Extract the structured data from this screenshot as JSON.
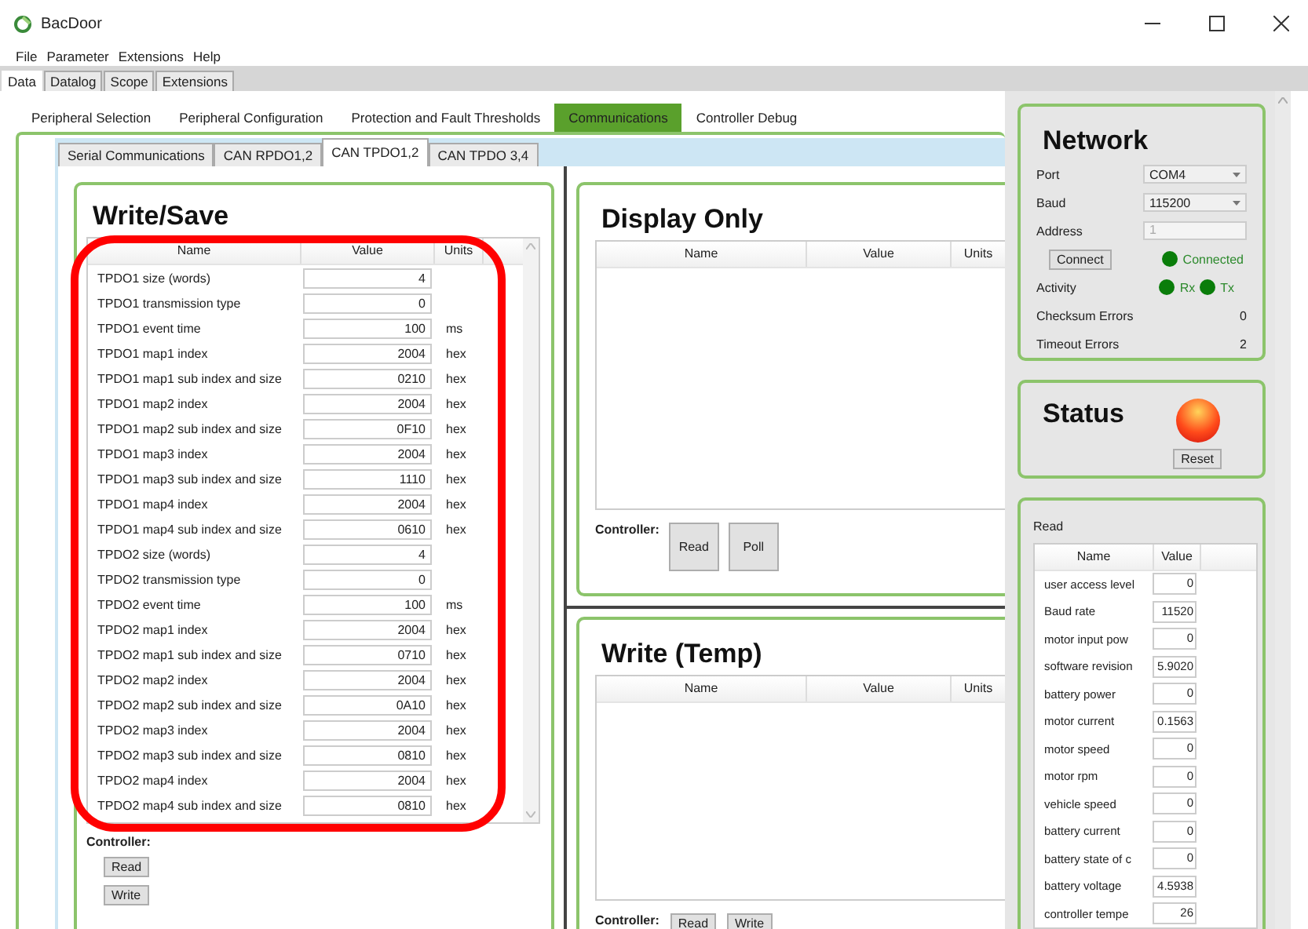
{
  "window": {
    "title": "BacDoor"
  },
  "menu": [
    "File",
    "Parameter",
    "Extensions",
    "Help"
  ],
  "main_tabs": [
    {
      "label": "Data",
      "selected": true
    },
    {
      "label": "Datalog",
      "selected": false
    },
    {
      "label": "Scope",
      "selected": false
    },
    {
      "label": "Extensions",
      "selected": false
    }
  ],
  "section_tabs": [
    {
      "label": "Peripheral Selection",
      "selected": false
    },
    {
      "label": "Peripheral Configuration",
      "selected": false
    },
    {
      "label": "Protection and Fault Thresholds",
      "selected": false
    },
    {
      "label": "Communications",
      "selected": true
    },
    {
      "label": "Controller Debug",
      "selected": false
    }
  ],
  "comm_tabs": [
    {
      "label": "Serial Communications",
      "selected": false
    },
    {
      "label": "CAN RPDO1,2",
      "selected": false
    },
    {
      "label": "CAN TPDO1,2",
      "selected": true
    },
    {
      "label": "CAN TPDO 3,4",
      "selected": false
    }
  ],
  "write_save": {
    "title": "Write/Save",
    "columns": [
      "Name",
      "Value",
      "Units"
    ],
    "rows": [
      {
        "name": "TPDO1 size (words)",
        "value": "4"
      },
      {
        "name": "TPDO1 transmission type",
        "value": "0"
      },
      {
        "name": "TPDO1 event time",
        "value": "100",
        "unit": "ms"
      },
      {
        "name": "TPDO1 map1 index",
        "value": "2004",
        "unit": "hex"
      },
      {
        "name": "TPDO1 map1 sub index and size",
        "value": "0210",
        "unit": "hex"
      },
      {
        "name": "TPDO1 map2 index",
        "value": "2004",
        "unit": "hex"
      },
      {
        "name": "TPDO1 map2 sub index and size",
        "value": "0F10",
        "unit": "hex"
      },
      {
        "name": "TPDO1 map3 index",
        "value": "2004",
        "unit": "hex"
      },
      {
        "name": "TPDO1 map3 sub index and size",
        "value": "1110",
        "unit": "hex"
      },
      {
        "name": "TPDO1 map4 index",
        "value": "2004",
        "unit": "hex"
      },
      {
        "name": "TPDO1 map4 sub index and size",
        "value": "0610",
        "unit": "hex"
      },
      {
        "name": "TPDO2 size (words)",
        "value": "4"
      },
      {
        "name": "TPDO2 transmission type",
        "value": "0"
      },
      {
        "name": "TPDO2 event time",
        "value": "100",
        "unit": "ms"
      },
      {
        "name": "TPDO2 map1 index",
        "value": "2004",
        "unit": "hex"
      },
      {
        "name": "TPDO2 map1 sub index and size",
        "value": "0710",
        "unit": "hex"
      },
      {
        "name": "TPDO2 map2 index",
        "value": "2004",
        "unit": "hex"
      },
      {
        "name": "TPDO2 map2 sub index and size",
        "value": "0A10",
        "unit": "hex"
      },
      {
        "name": "TPDO2 map3 index",
        "value": "2004",
        "unit": "hex"
      },
      {
        "name": "TPDO2 map3 sub index and size",
        "value": "0810",
        "unit": "hex"
      },
      {
        "name": "TPDO2 map4 index",
        "value": "2004",
        "unit": "hex"
      },
      {
        "name": "TPDO2 map4 sub index and size",
        "value": "0810",
        "unit": "hex"
      }
    ],
    "controller_label": "Controller:",
    "buttons": [
      "Read",
      "Write"
    ]
  },
  "display_only": {
    "title": "Display Only",
    "columns": [
      "Name",
      "Value",
      "Units"
    ],
    "controller_label": "Controller:",
    "buttons": [
      "Read",
      "Poll"
    ]
  },
  "write_temp": {
    "title": "Write (Temp)",
    "columns": [
      "Name",
      "Value",
      "Units"
    ],
    "controller_label": "Controller:",
    "buttons": [
      "Read",
      "Write"
    ]
  },
  "network": {
    "title": "Network",
    "port": {
      "label": "Port",
      "value": "COM4"
    },
    "baud": {
      "label": "Baud",
      "value": "115200"
    },
    "address": {
      "label": "Address",
      "value": "1",
      "disabled": true
    },
    "connect_button": "Connect",
    "connection": {
      "label": "Connected",
      "on": true
    },
    "activity": {
      "label": "Activity",
      "rx": {
        "label": "Rx",
        "on": true
      },
      "tx": {
        "label": "Tx",
        "on": true
      }
    },
    "checksum_errors": {
      "label": "Checksum Errors",
      "value": "0"
    },
    "timeout_errors": {
      "label": "Timeout Errors",
      "value": "2"
    }
  },
  "status": {
    "title": "Status",
    "fault": true,
    "reset_button": "Reset"
  },
  "read": {
    "title": "Read",
    "columns": [
      "Name",
      "Value"
    ],
    "rows": [
      {
        "name": "user access level",
        "value": "0"
      },
      {
        "name": "Baud rate",
        "value": "11520"
      },
      {
        "name": "motor input pow",
        "value": "0"
      },
      {
        "name": "software revision",
        "value": "5.9020"
      },
      {
        "name": "battery power",
        "value": "0"
      },
      {
        "name": "motor current",
        "value": "0.1563"
      },
      {
        "name": "motor speed",
        "value": "0"
      },
      {
        "name": "motor rpm",
        "value": "0"
      },
      {
        "name": "vehicle speed",
        "value": "0"
      },
      {
        "name": "battery current",
        "value": "0"
      },
      {
        "name": "battery state of c",
        "value": "0"
      },
      {
        "name": "battery voltage",
        "value": "4.5938"
      },
      {
        "name": "controller tempe",
        "value": "26"
      }
    ]
  },
  "annotation": {
    "kind": "outline"
  }
}
